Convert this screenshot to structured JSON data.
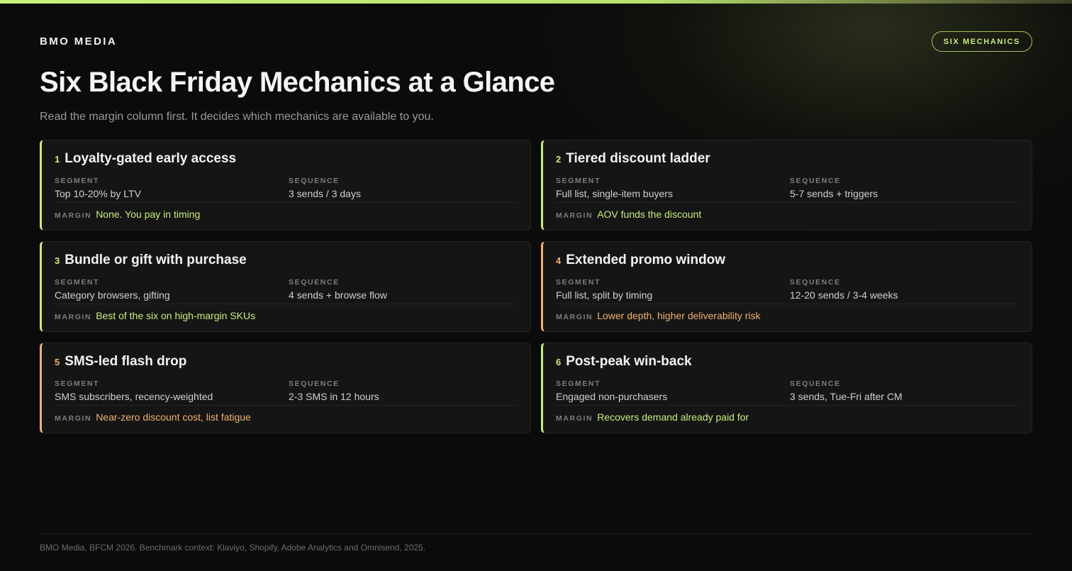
{
  "brand": "BMO MEDIA",
  "badge": "SIX MECHANICS",
  "title": "Six Black Friday Mechanics at a Glance",
  "subtitle": "Read the margin column first. It decides which mechanics are available to you.",
  "labels": {
    "segment": "SEGMENT",
    "sequence": "SEQUENCE",
    "margin": "MARGIN"
  },
  "colors": {
    "accent": "#c8ec7f",
    "warning": "#f0b070",
    "background": "#0b0b0b",
    "card": "#151515"
  },
  "cards": [
    {
      "number": "1",
      "title": "Loyalty-gated early access",
      "segment": "Top 10-20% by LTV",
      "sequence": "3 sends / 3 days",
      "margin": "None. You pay in timing",
      "tone": "green"
    },
    {
      "number": "2",
      "title": "Tiered discount ladder",
      "segment": "Full list, single-item buyers",
      "sequence": "5-7 sends + triggers",
      "margin": "AOV funds the discount",
      "tone": "green"
    },
    {
      "number": "3",
      "title": "Bundle or gift with purchase",
      "segment": "Category browsers, gifting",
      "sequence": "4 sends + browse flow",
      "margin": "Best of the six on high-margin SKUs",
      "tone": "green"
    },
    {
      "number": "4",
      "title": "Extended promo window",
      "segment": "Full list, split by timing",
      "sequence": "12-20 sends / 3-4 weeks",
      "margin": "Lower depth, higher deliverability risk",
      "tone": "orange"
    },
    {
      "number": "5",
      "title": "SMS-led flash drop",
      "segment": "SMS subscribers, recency-weighted",
      "sequence": "2-3 SMS in 12 hours",
      "margin": "Near-zero discount cost, list fatigue",
      "tone": "orange"
    },
    {
      "number": "6",
      "title": "Post-peak win-back",
      "segment": "Engaged non-purchasers",
      "sequence": "3 sends, Tue-Fri after CM",
      "margin": "Recovers demand already paid for",
      "tone": "green"
    }
  ],
  "footer": "BMO Media, BFCM 2026. Benchmark context: Klaviyo, Shopify, Adobe Analytics and Omnisend, 2025."
}
